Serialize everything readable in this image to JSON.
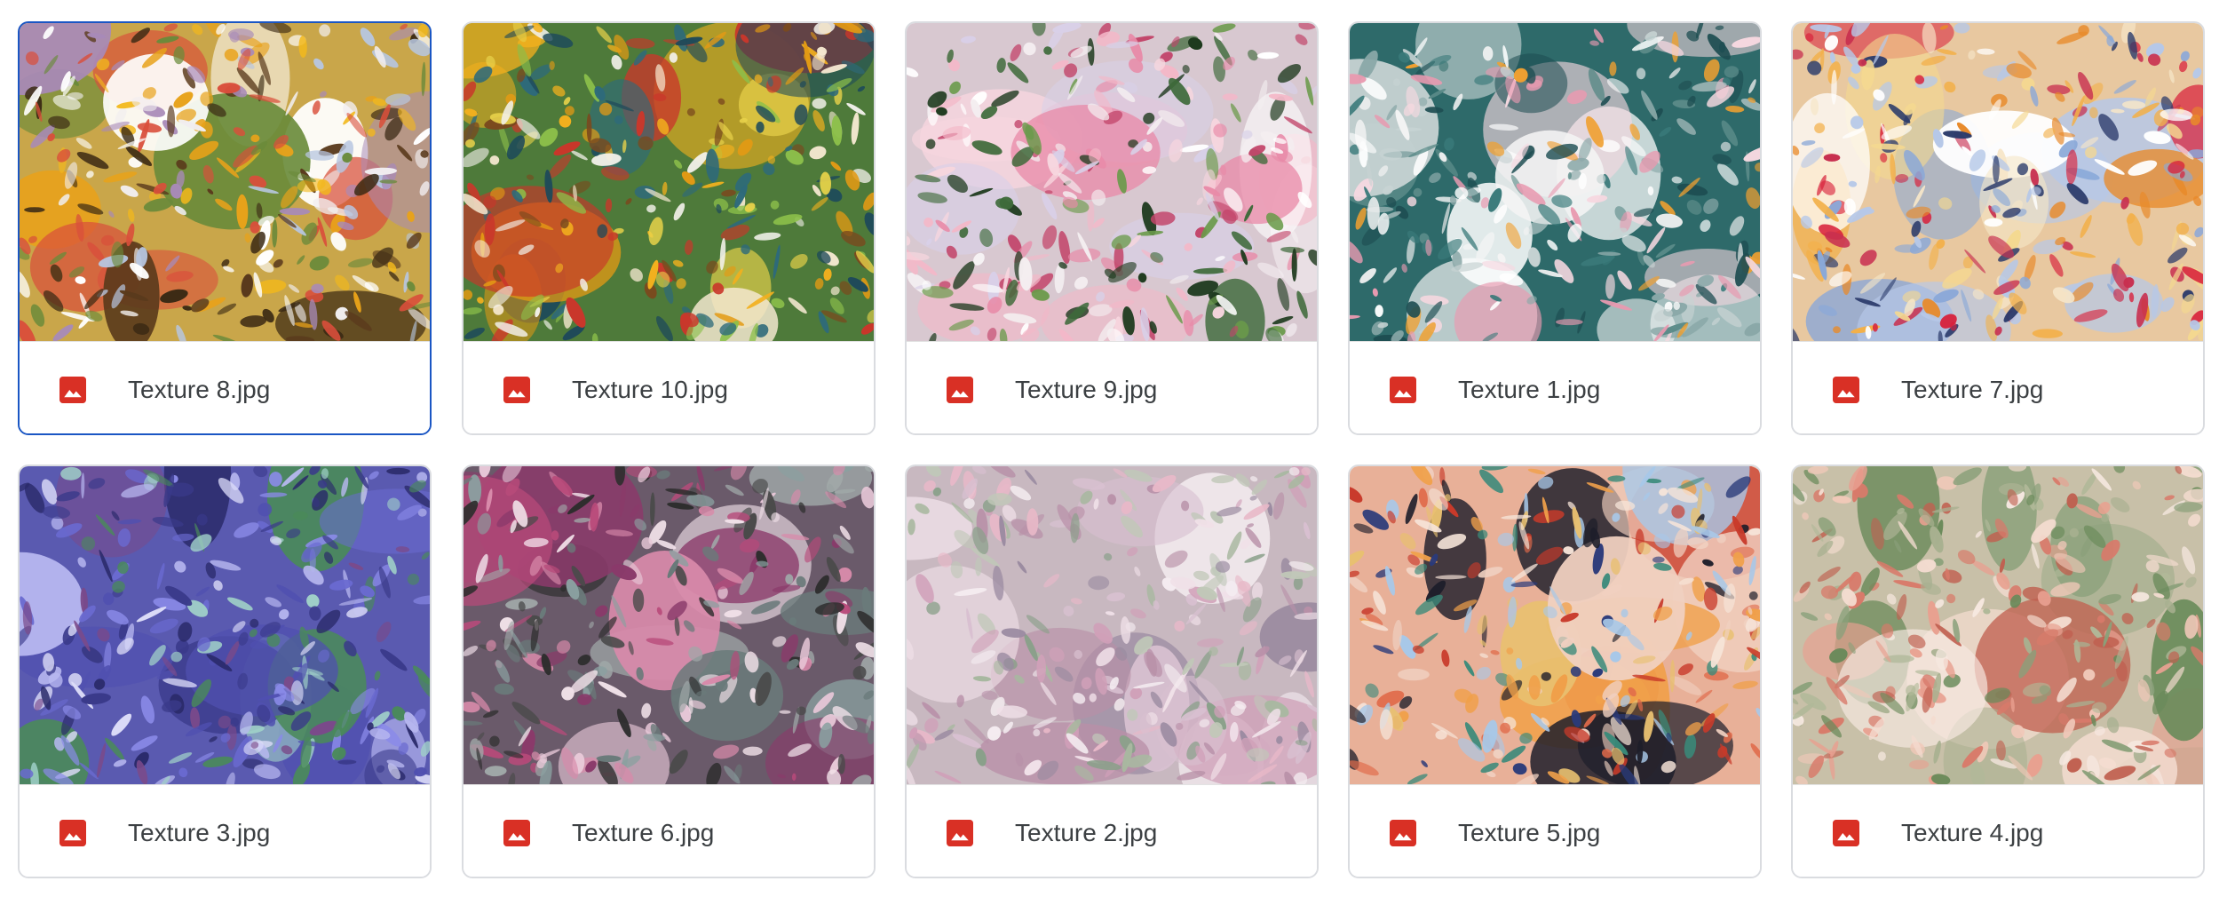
{
  "files": [
    {
      "name": "Texture 8.jpg",
      "selected": true,
      "palette": {
        "bg": "#c9a64a",
        "colors": [
          "#f2b81c",
          "#e8a21a",
          "#ffffff",
          "#f1eef0",
          "#5a3a1c",
          "#6a8a3a",
          "#a88ab8",
          "#d94f3b",
          "#3b2a14",
          "#b7c6e0"
        ]
      }
    },
    {
      "name": "Texture 10.jpg",
      "selected": false,
      "palette": {
        "bg": "#4e7a3a",
        "colors": [
          "#f2b01e",
          "#e39a14",
          "#2e6a7a",
          "#f3f1ea",
          "#c9372b",
          "#7a4a1e",
          "#8cbf4a",
          "#1e4a5a",
          "#e8d24a",
          "#f5e8d0"
        ]
      }
    },
    {
      "name": "Texture 9.jpg",
      "selected": false,
      "palette": {
        "bg": "#d8c8d0",
        "colors": [
          "#f3b8c8",
          "#e88aa8",
          "#ffffff",
          "#f4eef0",
          "#3e6a3a",
          "#6a9a4a",
          "#c2456a",
          "#1e3a1e",
          "#d8d0e8",
          "#f7d6de"
        ]
      }
    },
    {
      "name": "Texture 1.jpg",
      "selected": false,
      "palette": {
        "bg": "#2e6a6a",
        "colors": [
          "#ffffff",
          "#f4f4f4",
          "#e89ab0",
          "#f0a030",
          "#1e4e52",
          "#5a8a88",
          "#c7d3d3",
          "#3a7a7a",
          "#f6d8e0",
          "#8aa8a8"
        ]
      }
    },
    {
      "name": "Texture 7.jpg",
      "selected": false,
      "palette": {
        "bg": "#e8c8a0",
        "colors": [
          "#f6e6c8",
          "#f2b04a",
          "#d8203a",
          "#8aa8d8",
          "#ffffff",
          "#e88a2a",
          "#2a3a6a",
          "#f4d890",
          "#c83050",
          "#b6c8e8"
        ]
      }
    },
    {
      "name": "Texture 3.jpg",
      "selected": false,
      "palette": {
        "bg": "#5a5ab0",
        "colors": [
          "#6a6ad0",
          "#8a8ae8",
          "#3a3a8a",
          "#b8b8f0",
          "#4a8a5a",
          "#2a2a6a",
          "#a0d0c8",
          "#7a4a8a",
          "#dcdcf8",
          "#5050b0"
        ]
      }
    },
    {
      "name": "Texture 6.jpg",
      "selected": false,
      "palette": {
        "bg": "#6a5a6a",
        "colors": [
          "#b84a7a",
          "#d88aaa",
          "#4a4a4a",
          "#8aa0a0",
          "#e8c8d8",
          "#8a3a6a",
          "#2e2e2e",
          "#a0a8a8",
          "#f0e0e8",
          "#6a7a7a"
        ]
      }
    },
    {
      "name": "Texture 2.jpg",
      "selected": false,
      "palette": {
        "bg": "#c8b8c0",
        "colors": [
          "#e8b8c8",
          "#d0a0b8",
          "#a8b8a0",
          "#f0e0e8",
          "#b890a8",
          "#8aa08a",
          "#f4ecf0",
          "#c0c8b8",
          "#d8c0d0",
          "#9a8aa0"
        ]
      }
    },
    {
      "name": "Texture 5.jpg",
      "selected": false,
      "palette": {
        "bg": "#e8b098",
        "colors": [
          "#e06a4a",
          "#f0a04a",
          "#c83a2a",
          "#f0d0c0",
          "#2a3a7a",
          "#a8c8e8",
          "#3a8a7a",
          "#e8c070",
          "#1e1e2a",
          "#f6e4d8"
        ]
      }
    },
    {
      "name": "Texture 4.jpg",
      "selected": false,
      "palette": {
        "bg": "#c8c0a8",
        "colors": [
          "#f0c8b8",
          "#e8a090",
          "#8aa07a",
          "#f6e8e0",
          "#d87a6a",
          "#6a8a5a",
          "#b0b898",
          "#f4dcd0",
          "#c06050",
          "#a8b090"
        ]
      }
    }
  ],
  "icon": {
    "name": "image-file-icon",
    "color": "#d93025"
  }
}
